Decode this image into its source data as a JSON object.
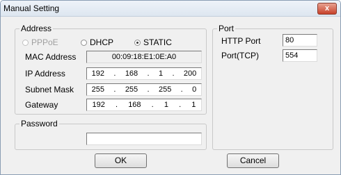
{
  "window": {
    "title": "Manual Setting",
    "close_glyph": "x"
  },
  "address": {
    "legend": "Address",
    "modes": [
      "PPPoE",
      "DHCP",
      "STATIC"
    ],
    "selected_mode": "STATIC",
    "mac_label": "MAC Address",
    "mac_value": "00:09:18:E1:0E:A0",
    "ip_label": "IP Address",
    "ip": [
      "192",
      "168",
      "1",
      "200"
    ],
    "subnet_label": "Subnet Mask",
    "subnet": [
      "255",
      "255",
      "255",
      "0"
    ],
    "gateway_label": "Gateway",
    "gateway": [
      "192",
      "168",
      "1",
      "1"
    ]
  },
  "password": {
    "legend": "Password",
    "value": ""
  },
  "port": {
    "legend": "Port",
    "http_label": "HTTP Port",
    "http_value": "80",
    "tcp_label": "Port(TCP)",
    "tcp_value": "554"
  },
  "buttons": {
    "ok": "OK",
    "cancel": "Cancel"
  }
}
